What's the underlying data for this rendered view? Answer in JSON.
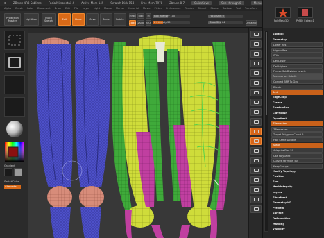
{
  "titlebar": {
    "app": "ZBrush 4R8 Sublime",
    "file": "FacialMicrodetail 4",
    "items": [
      "Active Mem 149",
      "Scratch Disk 158",
      "Free Mem 7978",
      "Zbrush 8.7"
    ],
    "quickload": "QuickSave",
    "see_through": "See-through 0",
    "menus": "Menus",
    "default_script": "DefaultZScript"
  },
  "menubar": [
    "Alpha",
    "Brush",
    "Color",
    "Document",
    "Draw",
    "Edit",
    "File",
    "Layer",
    "Light",
    "Macro",
    "Marker",
    "Material",
    "Movie",
    "Picker",
    "Preferences",
    "Render",
    "Stencil",
    "Stroke",
    "Texture",
    "Tool",
    "Transform",
    "Zplugin",
    "Zscript"
  ],
  "toolbar": {
    "projection_master": "Projection Master",
    "lightbox": "LightBox",
    "quick_sketch": "Quick Sketch",
    "draw": "Draw",
    "move": "Move",
    "scale": "Scale",
    "rotate": "Rotate",
    "edit": "Edit",
    "mrgb": "Mrgb",
    "rgb": "Rgb",
    "m": "M",
    "zadd": "Zadd",
    "zsub": "Zsub",
    "zcut": "Zcut",
    "focal_shift": "Focal Shift 0",
    "draw_size": "Draw Size 64",
    "z_intensity": "Z Intensity 25",
    "rgb_intensity": "Rgb Intensity 100",
    "dynamic": "Dynamic"
  },
  "left_shelf": {
    "gradient": "Gradient",
    "switch_color": "SwitchColor",
    "alternate": "Alternate"
  },
  "tray": {
    "top_labels": [
      "PolyMesh3D",
      "PM3D_Extract1"
    ],
    "rows": [
      {
        "label": "Subtool",
        "style": "head"
      },
      {
        "label": "Geometry",
        "style": "head"
      },
      {
        "label": "Lower Res",
        "style": "btn"
      },
      {
        "label": "Higher Res",
        "style": "btn"
      },
      {
        "label": "SDiv",
        "style": "btn"
      },
      {
        "label": "Del Lower",
        "style": "btn"
      },
      {
        "label": "Del Higher",
        "style": "btn"
      },
      {
        "label": "Freeze SubDivision Levels",
        "style": "btn"
      },
      {
        "label": "Reconstruct Subdiv",
        "style": "sel"
      },
      {
        "label": "Convert BPR To Geo",
        "style": "btn"
      },
      {
        "label": "Divide",
        "style": "btn"
      },
      {
        "label": "Smt",
        "style": "hl"
      },
      {
        "label": "EdgeLoop",
        "style": "head"
      },
      {
        "label": "Crease",
        "style": "head"
      },
      {
        "label": "ShadowBox",
        "style": "head"
      },
      {
        "label": "ClayPolish",
        "style": "head"
      },
      {
        "label": "DynaMesh",
        "style": "head"
      },
      {
        "label": "ZRemesher",
        "style": "hl"
      },
      {
        "label": "ZRemesher",
        "style": "btn"
      },
      {
        "label": "Target Polygons Count 5",
        "style": "btn"
      },
      {
        "label": "Half   Same   Double",
        "style": "btn"
      },
      {
        "label": "Adapt",
        "style": "hl"
      },
      {
        "label": "AdaptiveSize 50",
        "style": "btn"
      },
      {
        "label": "Use Polypaint",
        "style": "btn"
      },
      {
        "label": "Curves Strength 50",
        "style": "btn"
      },
      {
        "label": "KeepGroups",
        "style": "btn"
      },
      {
        "label": "Modify Topology",
        "style": "head"
      },
      {
        "label": "Position",
        "style": "head"
      },
      {
        "label": "Size",
        "style": "head"
      },
      {
        "label": "MeshIntegrity",
        "style": "head"
      },
      {
        "label": "Layers",
        "style": "head"
      },
      {
        "label": "FiberMesh",
        "style": "head"
      },
      {
        "label": "Geometry HD",
        "style": "head"
      },
      {
        "label": "Preview",
        "style": "head"
      },
      {
        "label": "Surface",
        "style": "head"
      },
      {
        "label": "Deformation",
        "style": "head"
      },
      {
        "label": "Masking",
        "style": "head"
      },
      {
        "label": "Visibility",
        "style": "head"
      }
    ]
  },
  "colors": {
    "accent": "#d96a18",
    "muscle_blue": "#4d50c8",
    "muscle_yellow": "#cfdc3a",
    "muscle_green": "#3faa3a",
    "muscle_magenta": "#c03fa0",
    "bone": "#d78c7a"
  },
  "viewport_icons": [
    "bpr-icon",
    "spix-icon",
    "scroll-icon",
    "zoom-icon",
    "actual-icon",
    "aahalf-icon",
    "persp-icon",
    "floor-icon",
    "local-icon",
    "lsym-icon",
    "xyz-icon",
    "frame-icon",
    "move-icon",
    "scale-icon",
    "rotate-icon",
    "polyf-icon",
    "transp-icon",
    "solo-icon",
    "xpose-icon"
  ]
}
